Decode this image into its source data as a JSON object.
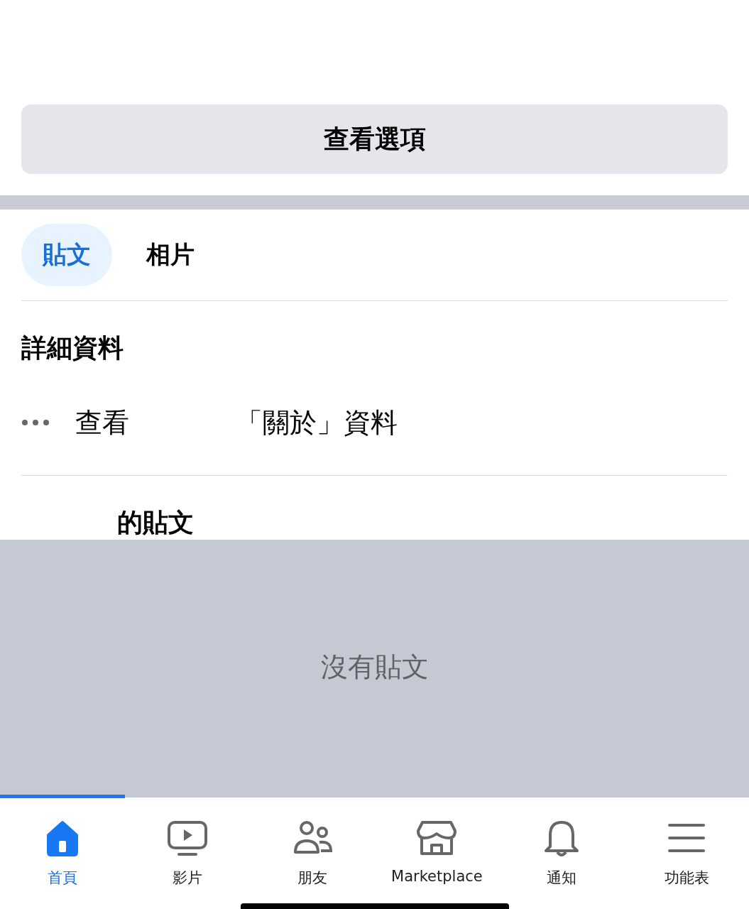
{
  "options_button": {
    "label": "查看選項"
  },
  "tabs": [
    {
      "label": "貼文",
      "selected": true
    },
    {
      "label": "相片",
      "selected": false
    }
  ],
  "details": {
    "heading": "詳細資料",
    "about_prefix": "查看",
    "about_suffix": "「關於」資料"
  },
  "posts": {
    "heading": "的貼文",
    "empty_message": "沒有貼文"
  },
  "bottom_nav": [
    {
      "label": "首頁",
      "selected": true
    },
    {
      "label": "影片",
      "selected": false
    },
    {
      "label": "朋友",
      "selected": false
    },
    {
      "label": "Marketplace",
      "selected": false
    },
    {
      "label": "通知",
      "selected": false
    },
    {
      "label": "功能表",
      "selected": false
    }
  ]
}
